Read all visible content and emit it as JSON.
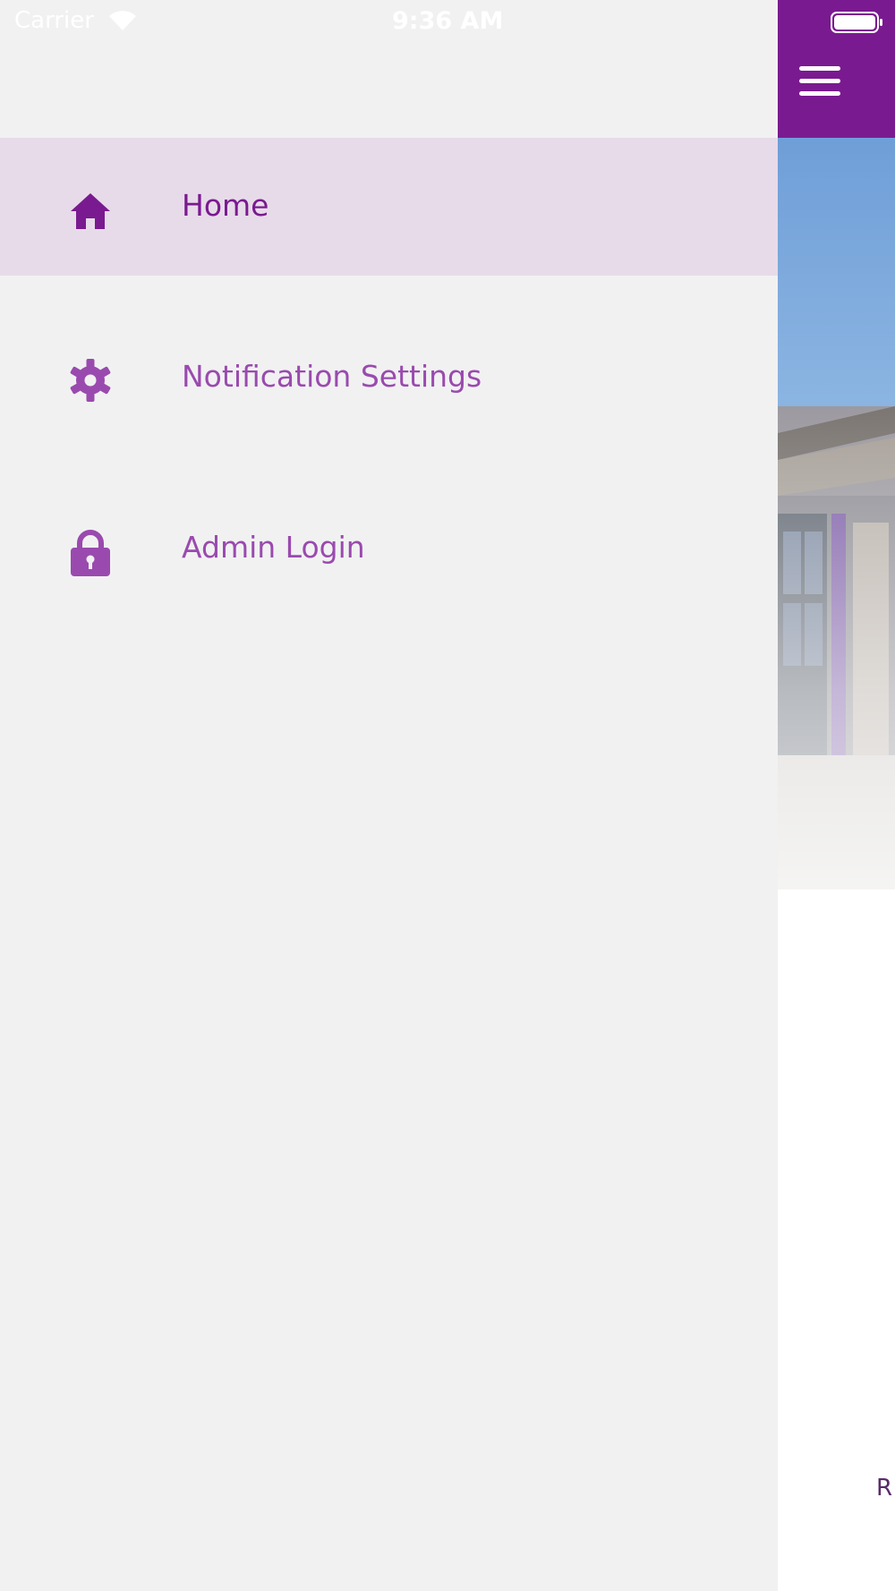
{
  "status_bar": {
    "carrier": "Carrier",
    "time": "9:36 AM",
    "wifi_icon": "wifi-icon",
    "battery_icon": "battery-icon"
  },
  "drawer": {
    "items": [
      {
        "label": "Home",
        "icon": "home-icon",
        "selected": true
      },
      {
        "label": "Notification Settings",
        "icon": "gear-icon",
        "selected": false
      },
      {
        "label": "Admin Login",
        "icon": "lock-icon",
        "selected": false
      }
    ]
  },
  "app": {
    "menu_icon": "hamburger-menu-icon",
    "footer_text": "R"
  },
  "colors": {
    "brand_purple": "#7a1a90",
    "selected_item_bg": "#e7dbe9",
    "drawer_bg": "#f1f1f2",
    "label_purple": "#9a4aae"
  }
}
